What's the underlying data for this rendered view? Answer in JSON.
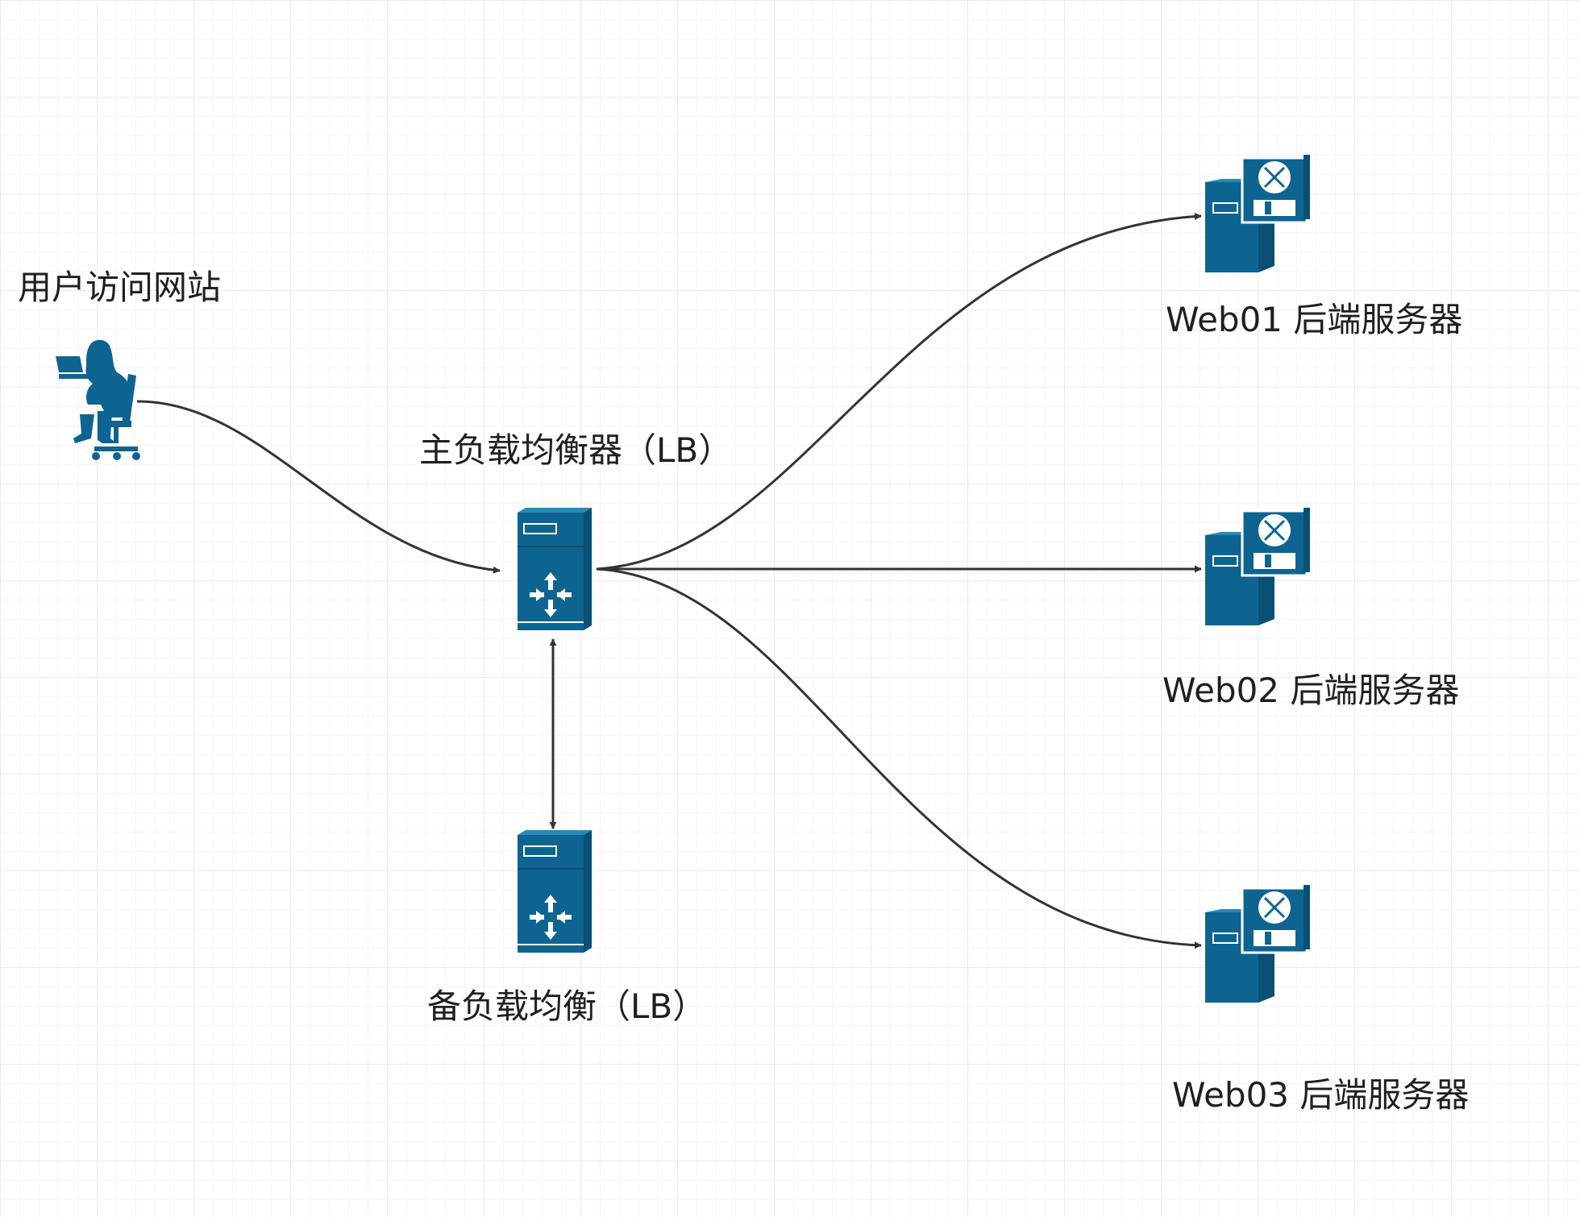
{
  "nodes": {
    "user": {
      "label": "用户访问网站",
      "icon": "person-laptop-icon"
    },
    "primary_lb": {
      "label": "主负载均衡器（LB）",
      "icon": "load-balancer-icon"
    },
    "backup_lb": {
      "label": "备负载均衡（LB）",
      "icon": "load-balancer-icon"
    },
    "web01": {
      "label": "Web01 后端服务器",
      "icon": "server-router-icon"
    },
    "web02": {
      "label": "Web02 后端服务器",
      "icon": "server-router-icon"
    },
    "web03": {
      "label": "Web03 后端服务器",
      "icon": "server-router-icon"
    }
  },
  "edges": [
    {
      "from": "user",
      "to": "primary_lb",
      "direction": "forward"
    },
    {
      "from": "primary_lb",
      "to": "web01",
      "direction": "forward"
    },
    {
      "from": "primary_lb",
      "to": "web02",
      "direction": "forward"
    },
    {
      "from": "primary_lb",
      "to": "web03",
      "direction": "forward"
    },
    {
      "from": "primary_lb",
      "to": "backup_lb",
      "direction": "both"
    }
  ],
  "colors": {
    "icon": "#0E6491",
    "icon_light": "#2A88B8",
    "edge": "#333333"
  }
}
